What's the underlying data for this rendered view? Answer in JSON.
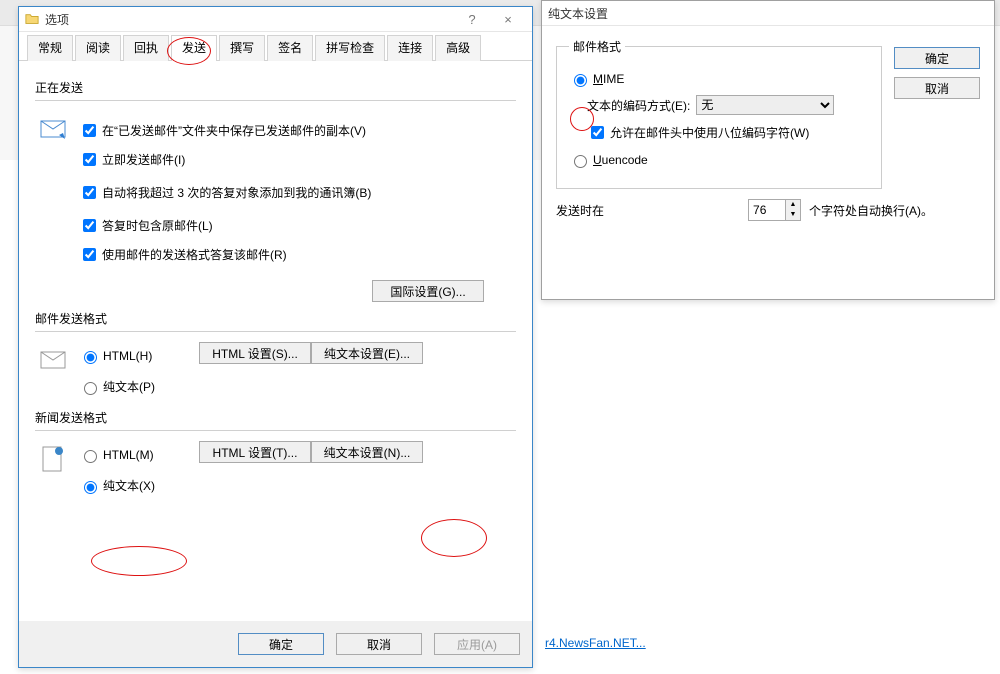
{
  "mainWindow": {
    "title": "选项",
    "helpGlyph": "?",
    "closeGlyph": "×",
    "tabs": [
      "常规",
      "阅读",
      "回执",
      "发送",
      "撰写",
      "签名",
      "拼写检查",
      "连接",
      "高级"
    ],
    "activeTab": 3,
    "sending": {
      "legend": "正在发送",
      "c1": "在“已发送邮件”文件夹中保存已发送邮件的副本(V)",
      "c2": "立即发送邮件(I)",
      "c3": "自动将我超过 3 次的答复对象添加到我的通讯簿(B)",
      "c4": "答复时包含原邮件(L)",
      "c5": "使用邮件的发送格式答复该邮件(R)",
      "intlBtn": "国际设置(G)..."
    },
    "mailFmt": {
      "legend": "邮件发送格式",
      "html": "HTML(H)",
      "plain": "纯文本(P)",
      "htmlBtn": "HTML 设置(S)...",
      "plainBtn": "纯文本设置(E)..."
    },
    "newsFmt": {
      "legend": "新闻发送格式",
      "html": "HTML(M)",
      "plain": "纯文本(X)",
      "htmlBtn": "HTML 设置(T)...",
      "plainBtn": "纯文本设置(N)..."
    },
    "footer": {
      "ok": "确定",
      "cancel": "取消",
      "apply": "应用(A)"
    }
  },
  "plainDlg": {
    "title": "纯文本设置",
    "legend": "邮件格式",
    "mime": "MIME",
    "encLabel": "文本的编码方式(E):",
    "encValue": "无",
    "eightBit": "允许在邮件头中使用八位编码字符(W)",
    "uuencode": "Uuencode",
    "wrapBefore": "发送时在",
    "wrapValue": "76",
    "wrapAfter": "个字符处自动换行(A)。",
    "ok": "确定",
    "cancel": "取消"
  },
  "bgLink": "r4.NewsFan.NET..."
}
